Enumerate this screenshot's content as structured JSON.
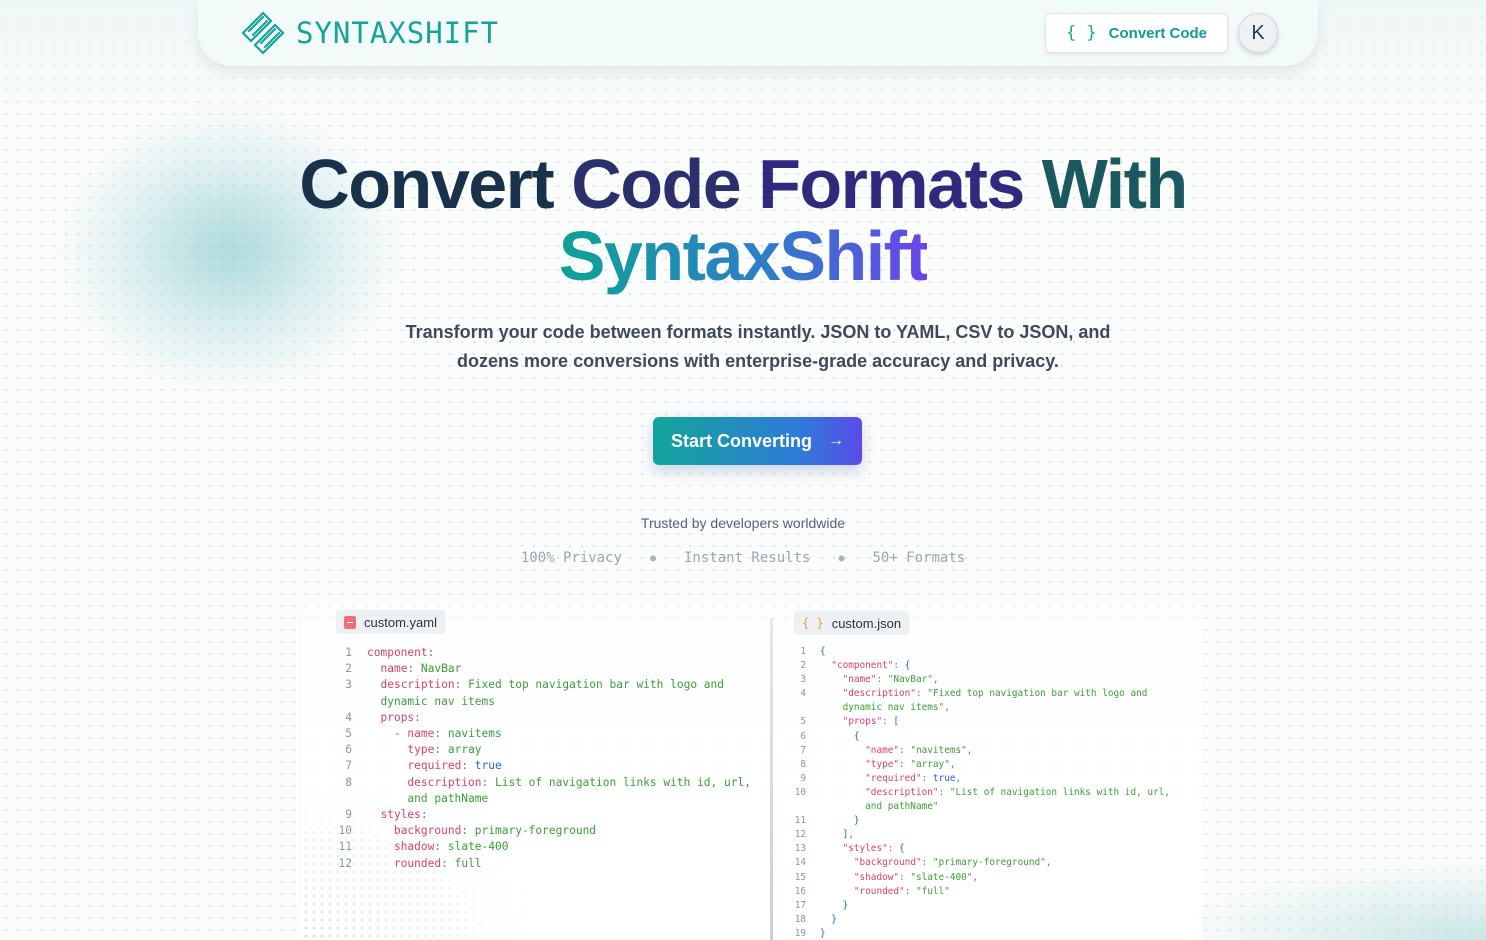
{
  "brand": {
    "name": "SYNTAXSHIFT"
  },
  "nav": {
    "convert_label": "Convert Code",
    "avatar_initial": "K"
  },
  "hero": {
    "title_words": [
      "Convert",
      "Code",
      "Formats",
      "With"
    ],
    "title_brand": "SyntaxShift",
    "subtitle": "Transform your code between formats instantly. JSON to YAML, CSV to JSON, and dozens more conversions with enterprise-grade accuracy and privacy.",
    "cta_label": "Start Converting"
  },
  "trust": {
    "label": "Trusted by developers worldwide",
    "features": [
      "100% Privacy",
      "Instant Results",
      "50+ Formats"
    ]
  },
  "colors": {
    "brand_teal": "#16a39a",
    "brand_indigo": "#5a4bea",
    "title_navy": "#17324a"
  },
  "icons": {
    "logo": "striped-diamond-logo-icon",
    "convert": "braces-icon",
    "cta": "arrow-right-icon",
    "yaml_file": "yaml-file-icon",
    "json_file": "braces-file-icon"
  },
  "yaml_panel": {
    "filename": "custom.yaml",
    "lines": [
      {
        "n": "1",
        "parts": [
          [
            "k",
            "component"
          ],
          [
            "p",
            ":"
          ]
        ]
      },
      {
        "n": "2",
        "parts": [
          [
            "t",
            "  "
          ],
          [
            "k",
            "name"
          ],
          [
            "p",
            ": "
          ],
          [
            "s",
            "NavBar"
          ]
        ]
      },
      {
        "n": "3",
        "parts": [
          [
            "t",
            "  "
          ],
          [
            "k",
            "description"
          ],
          [
            "p",
            ": "
          ],
          [
            "s",
            "Fixed top navigation bar with logo and"
          ]
        ]
      },
      {
        "n": "",
        "parts": [
          [
            "s",
            "  dynamic nav items"
          ]
        ]
      },
      {
        "n": "4",
        "parts": [
          [
            "t",
            "  "
          ],
          [
            "k",
            "props"
          ],
          [
            "p",
            ":"
          ]
        ]
      },
      {
        "n": "5",
        "parts": [
          [
            "t",
            "    "
          ],
          [
            "k",
            "- name"
          ],
          [
            "p",
            ": "
          ],
          [
            "s",
            "navitems"
          ]
        ]
      },
      {
        "n": "6",
        "parts": [
          [
            "t",
            "      "
          ],
          [
            "k",
            "type"
          ],
          [
            "p",
            ": "
          ],
          [
            "s",
            "array"
          ]
        ]
      },
      {
        "n": "7",
        "parts": [
          [
            "t",
            "      "
          ],
          [
            "k",
            "required"
          ],
          [
            "p",
            ": "
          ],
          [
            "b",
            "true"
          ]
        ]
      },
      {
        "n": "8",
        "parts": [
          [
            "t",
            "      "
          ],
          [
            "k",
            "description"
          ],
          [
            "p",
            ": "
          ],
          [
            "s",
            "List of navigation links with id, url,"
          ]
        ]
      },
      {
        "n": "",
        "parts": [
          [
            "s",
            "      and pathName"
          ]
        ]
      },
      {
        "n": "9",
        "parts": [
          [
            "t",
            "  "
          ],
          [
            "k",
            "styles"
          ],
          [
            "p",
            ":"
          ]
        ]
      },
      {
        "n": "10",
        "parts": [
          [
            "t",
            "    "
          ],
          [
            "k",
            "background"
          ],
          [
            "p",
            ": "
          ],
          [
            "s",
            "primary-foreground"
          ]
        ]
      },
      {
        "n": "11",
        "parts": [
          [
            "t",
            "    "
          ],
          [
            "k",
            "shadow"
          ],
          [
            "p",
            ": "
          ],
          [
            "s",
            "slate-400"
          ]
        ]
      },
      {
        "n": "12",
        "parts": [
          [
            "t",
            "    "
          ],
          [
            "k",
            "rounded"
          ],
          [
            "p",
            ": "
          ],
          [
            "s",
            "full"
          ]
        ]
      }
    ]
  },
  "json_panel": {
    "filename": "custom.json",
    "lines": [
      {
        "n": "1",
        "parts": [
          [
            "b",
            "{"
          ]
        ]
      },
      {
        "n": "2",
        "parts": [
          [
            "t",
            "  "
          ],
          [
            "k",
            "\"component\""
          ],
          [
            "p",
            ": "
          ],
          [
            "b",
            "{"
          ]
        ]
      },
      {
        "n": "3",
        "parts": [
          [
            "t",
            "    "
          ],
          [
            "k",
            "\"name\""
          ],
          [
            "p",
            ": "
          ],
          [
            "s",
            "\"NavBar\""
          ],
          [
            "p",
            ","
          ]
        ]
      },
      {
        "n": "4",
        "parts": [
          [
            "t",
            "    "
          ],
          [
            "k",
            "\"description\""
          ],
          [
            "p",
            ": "
          ],
          [
            "s",
            "\"Fixed top navigation bar with logo and"
          ]
        ]
      },
      {
        "n": "",
        "parts": [
          [
            "s",
            "    dynamic nav items\""
          ],
          [
            "p",
            ","
          ]
        ]
      },
      {
        "n": "5",
        "parts": [
          [
            "t",
            "    "
          ],
          [
            "k",
            "\"props\""
          ],
          [
            "p",
            ": "
          ],
          [
            "b",
            "["
          ]
        ]
      },
      {
        "n": "6",
        "parts": [
          [
            "t",
            "      "
          ],
          [
            "b",
            "{"
          ]
        ]
      },
      {
        "n": "7",
        "parts": [
          [
            "t",
            "        "
          ],
          [
            "k",
            "\"name\""
          ],
          [
            "p",
            ": "
          ],
          [
            "s",
            "\"navitems\""
          ],
          [
            "p",
            ","
          ]
        ]
      },
      {
        "n": "8",
        "parts": [
          [
            "t",
            "        "
          ],
          [
            "k",
            "\"type\""
          ],
          [
            "p",
            ": "
          ],
          [
            "s",
            "\"array\""
          ],
          [
            "p",
            ","
          ]
        ]
      },
      {
        "n": "9",
        "parts": [
          [
            "t",
            "        "
          ],
          [
            "k",
            "\"required\""
          ],
          [
            "p",
            ": "
          ],
          [
            "b",
            "true"
          ],
          [
            "p",
            ","
          ]
        ]
      },
      {
        "n": "10",
        "parts": [
          [
            "t",
            "        "
          ],
          [
            "k",
            "\"description\""
          ],
          [
            "p",
            ": "
          ],
          [
            "s",
            "\"List of navigation links with id, url,"
          ]
        ]
      },
      {
        "n": "",
        "parts": [
          [
            "s",
            "        and pathName\""
          ]
        ]
      },
      {
        "n": "11",
        "parts": [
          [
            "t",
            "      "
          ],
          [
            "b",
            "}"
          ]
        ]
      },
      {
        "n": "12",
        "parts": [
          [
            "t",
            "    "
          ],
          [
            "b",
            "]"
          ],
          [
            "p",
            ","
          ]
        ]
      },
      {
        "n": "13",
        "parts": [
          [
            "t",
            "    "
          ],
          [
            "k",
            "\"styles\""
          ],
          [
            "p",
            ": "
          ],
          [
            "b",
            "{"
          ]
        ]
      },
      {
        "n": "14",
        "parts": [
          [
            "t",
            "      "
          ],
          [
            "k",
            "\"background\""
          ],
          [
            "p",
            ": "
          ],
          [
            "s",
            "\"primary-foreground\""
          ],
          [
            "p",
            ","
          ]
        ]
      },
      {
        "n": "15",
        "parts": [
          [
            "t",
            "      "
          ],
          [
            "k",
            "\"shadow\""
          ],
          [
            "p",
            ": "
          ],
          [
            "s",
            "\"slate-400\""
          ],
          [
            "p",
            ","
          ]
        ]
      },
      {
        "n": "16",
        "parts": [
          [
            "t",
            "      "
          ],
          [
            "k",
            "\"rounded\""
          ],
          [
            "p",
            ": "
          ],
          [
            "s",
            "\"full\""
          ]
        ]
      },
      {
        "n": "17",
        "parts": [
          [
            "t",
            "    "
          ],
          [
            "b",
            "}"
          ]
        ]
      },
      {
        "n": "18",
        "parts": [
          [
            "t",
            "  "
          ],
          [
            "b",
            "}"
          ]
        ]
      },
      {
        "n": "19",
        "parts": [
          [
            "b",
            "}"
          ]
        ]
      }
    ]
  }
}
